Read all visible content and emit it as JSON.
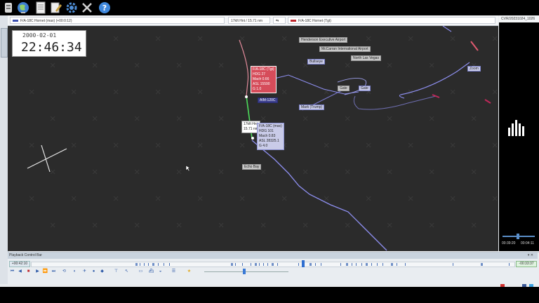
{
  "toolbar": {
    "icons": [
      "server-icon",
      "globe-icon",
      "document-icon",
      "edit-icon",
      "gear-icon",
      "tools-icon",
      "help-icon"
    ]
  },
  "tabs": {
    "left_aircraft": "F/A-18C Hornet (max) (+00:0:12)",
    "center_range": "17kft Hnt / 15.71 nm",
    "right_aircraft": "F/A-18C Hornet (Tgt)"
  },
  "map": {
    "clock_date": "2000-02-01",
    "clock_time": "22:46:34",
    "labels": {
      "henderson": "Henderson Executive Airport",
      "mccarran": "McCarran International Airport",
      "bullseye": "Bullseye",
      "north_las_vegas": "North Las Vegas",
      "gate": "Gate",
      "rp_aim": "AIM-120C",
      "mark_trump": "Mark (Trump)",
      "echo_bay": "Echo Bay",
      "zoom": "Zoom"
    },
    "red_block": {
      "title": "F/A-18C (Tgt)",
      "l1": "HDG 27",
      "l2": "Mach 0.66",
      "l3": "ASL 15590",
      "l4": "G 1.0"
    },
    "blue_block": {
      "title": "F/A-18C (max)",
      "l1": "HDG 101",
      "l2": "Mach 0.83",
      "l3": "ASL 28325.1",
      "l4": "G 4.0"
    },
    "range_block": {
      "l1": "17kft Hnt",
      "l2": "15.71 nm"
    }
  },
  "right_panel": {
    "title": "CVR/20231024_1026",
    "time_start": "00:39:20",
    "time_end": "00:04:11"
  },
  "playback": {
    "title": "Playback Control Bar",
    "left_time": "+00:42:10",
    "right_time": "-00:33:37"
  },
  "colors": {
    "map_bg": "#2b2b2b",
    "track_blue": "#8e8ff0",
    "track_red": "#e05a70",
    "segment_green": "#4cdb5a"
  }
}
